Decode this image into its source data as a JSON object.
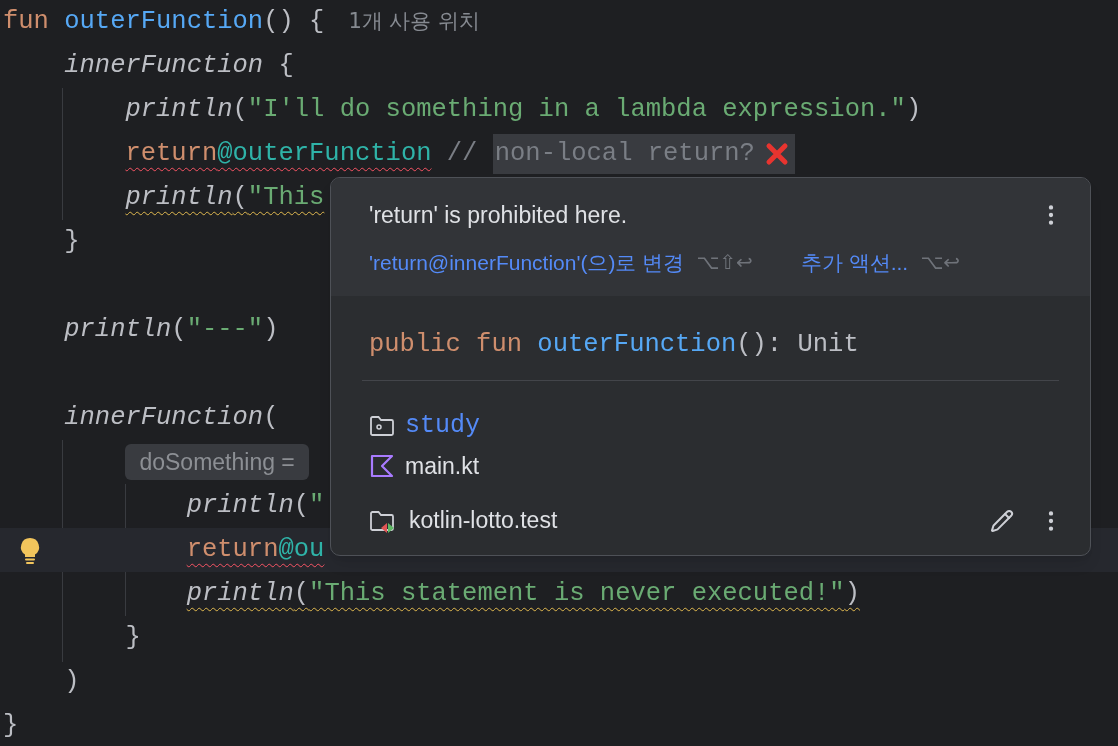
{
  "editor": {
    "lines": [
      {
        "tokens": [
          {
            "text": "fun",
            "kind": "keyword"
          },
          {
            "text": " outerFunction",
            "kind": "decl"
          },
          {
            "text": "() {",
            "kind": "plain"
          }
        ],
        "hint": {
          "text": "1개 사용 위치",
          "kind": "usage"
        }
      },
      {
        "tokens": [
          {
            "text": "    innerFunction",
            "kind": "call"
          },
          {
            "text": " {",
            "kind": "plain"
          }
        ]
      },
      {
        "tokens": [
          {
            "text": "        println",
            "kind": "call"
          },
          {
            "text": "(",
            "kind": "plain"
          },
          {
            "text": "\"I'll do something in a lambda expression.\"",
            "kind": "string"
          },
          {
            "text": ")",
            "kind": "plain"
          }
        ]
      },
      {
        "tokens": [
          {
            "text": "        return",
            "kind": "keyword",
            "error": true
          },
          {
            "text": "@outerFunction",
            "kind": "label",
            "error": true
          },
          {
            "text": " // ",
            "kind": "comment"
          }
        ],
        "highlight": {
          "text": "non-local return?",
          "cross": true
        }
      },
      {
        "tokens": [
          {
            "text": "        println",
            "kind": "call",
            "warning": true
          },
          {
            "text": "(",
            "kind": "plain",
            "warning": true
          },
          {
            "text": "\"This",
            "kind": "string",
            "warning": true
          }
        ]
      },
      {
        "tokens": [
          {
            "text": "    }",
            "kind": "plain"
          }
        ]
      },
      {
        "tokens": [
          {
            "text": "    println",
            "kind": "call"
          },
          {
            "text": "(",
            "kind": "plain"
          },
          {
            "text": "\"---\"",
            "kind": "string"
          },
          {
            "text": ")",
            "kind": "plain"
          }
        ],
        "after_blank": true
      },
      {
        "tokens": [
          {
            "text": "    innerFunction",
            "kind": "call"
          },
          {
            "text": "(",
            "kind": "plain"
          }
        ],
        "after_blank": true
      },
      {
        "hint": {
          "text": "        doSomething =",
          "kind": "parameter"
        }
      },
      {
        "tokens": [
          {
            "text": "            println",
            "kind": "call"
          },
          {
            "text": "(",
            "kind": "plain"
          },
          {
            "text": "\"",
            "kind": "string"
          }
        ]
      },
      {
        "tokens": [
          {
            "text": "            return",
            "kind": "keyword",
            "error": true
          },
          {
            "text": "@ou",
            "kind": "label",
            "error": true
          }
        ],
        "current": true,
        "bulb": true
      },
      {
        "tokens": [
          {
            "text": "            println",
            "kind": "call",
            "warning": true
          },
          {
            "text": "(",
            "kind": "plain",
            "warning": true
          },
          {
            "text": "\"This statement is never executed!\"",
            "kind": "string",
            "warning": true
          },
          {
            "text": ")",
            "kind": "plain",
            "warning": true
          }
        ]
      },
      {
        "tokens": [
          {
            "text": "        }",
            "kind": "plain"
          }
        ]
      },
      {
        "tokens": [
          {
            "text": "    )",
            "kind": "plain"
          }
        ]
      },
      {
        "tokens": [
          {
            "text": "}",
            "kind": "plain"
          }
        ]
      }
    ]
  },
  "popup": {
    "message": "'return' is prohibited here.",
    "actions": [
      {
        "label": "'return@innerFunction'(으)로 변경",
        "shortcut": "⌥⇧↩"
      },
      {
        "label": "추가 액션...",
        "shortcut": "⌥↩"
      }
    ],
    "signature": [
      {
        "text": "public fun ",
        "kind": "keyword"
      },
      {
        "text": "outerFunction",
        "kind": "decl"
      },
      {
        "text": "(): Unit",
        "kind": "plain"
      }
    ],
    "module": "study",
    "file": "main.kt",
    "project": "kotlin-lotto.test"
  }
}
